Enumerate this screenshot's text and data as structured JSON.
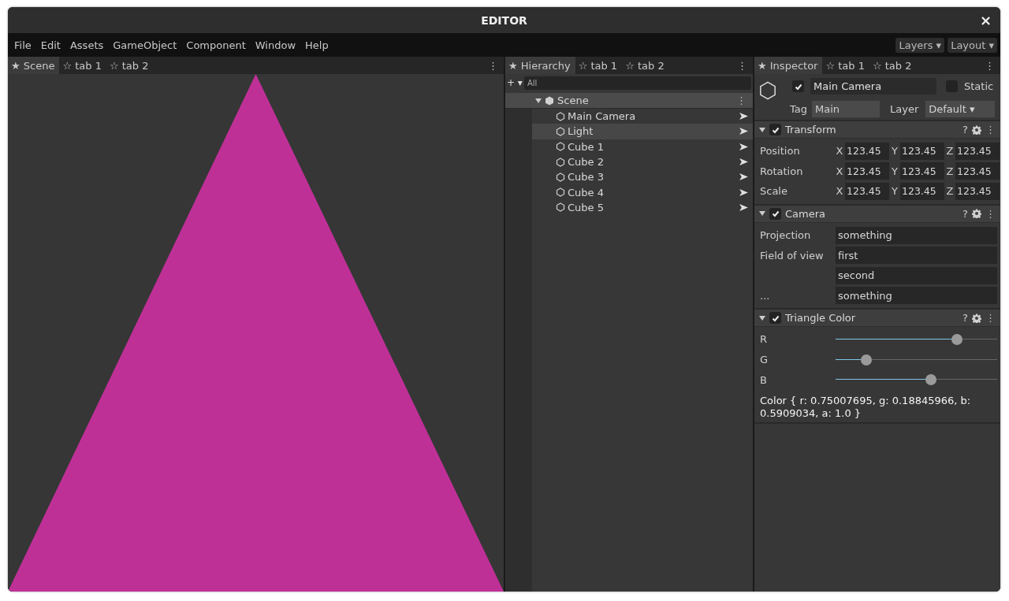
{
  "window": {
    "title": "EDITOR",
    "close": "×"
  },
  "menu": [
    "File",
    "Edit",
    "Assets",
    "GameObject",
    "Component",
    "Window",
    "Help"
  ],
  "menu_right": [
    "Layers ▾",
    "Layout ▾"
  ],
  "scene_panel": {
    "tabs": [
      {
        "label": "★ Scene",
        "selected": true
      },
      {
        "label": "☆ tab 1",
        "selected": false
      },
      {
        "label": "☆ tab 2",
        "selected": false
      }
    ],
    "more": "⋮"
  },
  "hierarchy": {
    "tabs": [
      {
        "label": "★ Hierarchy",
        "selected": true
      },
      {
        "label": "☆ tab 1",
        "selected": false
      },
      {
        "label": "☆ tab 2",
        "selected": false
      }
    ],
    "more": "⋮",
    "add": "+ ▾",
    "filter_placeholder": "All",
    "tree": {
      "label": "Scene",
      "expanded": true,
      "more": "⋮",
      "children": [
        {
          "label": "Main Camera",
          "selected": false
        },
        {
          "label": "Light",
          "selected": true
        },
        {
          "label": "Cube 1",
          "selected": false
        },
        {
          "label": "Cube 2",
          "selected": false
        },
        {
          "label": "Cube 3",
          "selected": false
        },
        {
          "label": "Cube 4",
          "selected": false
        },
        {
          "label": "Cube 5",
          "selected": false
        }
      ]
    }
  },
  "inspector": {
    "tabs": [
      {
        "label": "★ Inspector",
        "selected": true
      },
      {
        "label": "☆ tab 1",
        "selected": false
      },
      {
        "label": "☆ tab 2",
        "selected": false
      }
    ],
    "more": "⋮",
    "object": {
      "enabled": true,
      "name": "Main Camera",
      "static_label": "Static",
      "static": false,
      "tag_label": "Tag",
      "tag": "Main",
      "layer_label": "Layer",
      "layer": "Default ▾"
    },
    "components": [
      {
        "kind": "vector",
        "title": "Transform",
        "enabled": true,
        "expanded": true,
        "help": "?",
        "more": "⋮",
        "rows": [
          {
            "label": "Position",
            "fields": [
              {
                "axis": "X",
                "value": "123.45"
              },
              {
                "axis": "Y",
                "value": "123.45"
              },
              {
                "axis": "Z",
                "value": "123.45"
              }
            ]
          },
          {
            "label": "Rotation",
            "fields": [
              {
                "axis": "X",
                "value": "123.45"
              },
              {
                "axis": "Y",
                "value": "123.45"
              },
              {
                "axis": "Z",
                "value": "123.45"
              }
            ]
          },
          {
            "label": "Scale",
            "fields": [
              {
                "axis": "X",
                "value": "123.45"
              },
              {
                "axis": "Y",
                "value": "123.45"
              },
              {
                "axis": "Z",
                "value": "123.45"
              }
            ]
          }
        ]
      },
      {
        "kind": "fields",
        "title": "Camera",
        "enabled": true,
        "expanded": true,
        "help": "?",
        "more": "⋮",
        "rows": [
          {
            "label": "Projection",
            "value": "something"
          },
          {
            "label": "Field of view",
            "value": "first"
          },
          {
            "value": "second"
          },
          {
            "label": "...",
            "value": "something"
          }
        ]
      },
      {
        "kind": "sliders",
        "title": "Triangle Color",
        "enabled": true,
        "expanded": true,
        "help": "?",
        "more": "⋮",
        "rows": [
          {
            "label": "R",
            "level": 0.75
          },
          {
            "label": "G",
            "level": 0.188
          },
          {
            "label": "B",
            "level": 0.591
          }
        ],
        "note": "Color { r: 0.75007695, g: 0.18845966, b: 0.5909034, a: 1.0 }"
      }
    ]
  }
}
